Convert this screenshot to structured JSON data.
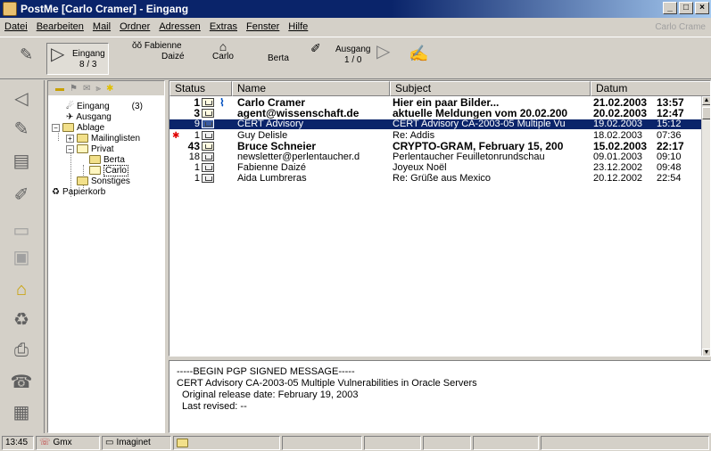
{
  "window": {
    "title": "PostMe [Carlo Cramer] - Eingang",
    "controls": [
      "_",
      "□",
      "×"
    ]
  },
  "menu": {
    "items": [
      "Datei",
      "Bearbeiten",
      "Mail",
      "Ordner",
      "Adressen",
      "Extras",
      "Fenster",
      "Hilfe"
    ],
    "user": "Carlo Crame"
  },
  "toolbar": {
    "inbox_label": "Eingang",
    "inbox_count": "8 / 3",
    "fab_label_1": "Fabienne",
    "fab_label_2": "Daizé",
    "carlo_label": "Carlo",
    "berta_label": "Berta",
    "outbox_label": "Ausgang",
    "outbox_count": "1 / 0"
  },
  "tree": {
    "inbox": "Eingang",
    "inbox_count": "(3)",
    "outbox": "Ausgang",
    "archive": "Ablage",
    "mailing": "Mailinglisten",
    "private": "Privat",
    "berta": "Berta",
    "carlo": "Carlo",
    "misc": "Sonstiges",
    "trash": "Papierkorb"
  },
  "columns": {
    "status": "Status",
    "name": "Name",
    "subject": "Subject",
    "date": "Datum"
  },
  "messages": [
    {
      "count": "1",
      "name": "Carlo Cramer",
      "subject": "Hier ein paar Bilder...",
      "date": "21.02.2003",
      "time": "13:57",
      "bold": true,
      "attachment": true,
      "selected": false,
      "marked": false
    },
    {
      "count": "3",
      "name": "agent@wissenschaft.de",
      "subject": "aktuelle Meldungen vom 20.02.200",
      "date": "20.02.2003",
      "time": "12:47",
      "bold": true,
      "attachment": false,
      "selected": false,
      "marked": false
    },
    {
      "count": "9",
      "name": "CERT Advisory",
      "subject": "CERT Advisory CA-2003-05 Multiple Vu",
      "date": "19.02.2003",
      "time": "15:12",
      "bold": false,
      "attachment": false,
      "selected": true,
      "marked": false
    },
    {
      "count": "1",
      "name": "Guy Delisle",
      "subject": "Re: Addis",
      "date": "18.02.2003",
      "time": "07:36",
      "bold": false,
      "attachment": false,
      "selected": false,
      "marked": true
    },
    {
      "count": "43",
      "name": "Bruce Schneier",
      "subject": "CRYPTO-GRAM, February 15, 200",
      "date": "15.02.2003",
      "time": "22:17",
      "bold": true,
      "attachment": false,
      "selected": false,
      "marked": false
    },
    {
      "count": "18",
      "name": "newsletter@perlentaucher.d",
      "subject": "Perlentaucher Feuilletonrundschau",
      "date": "09.01.2003",
      "time": "09:10",
      "bold": false,
      "attachment": false,
      "selected": false,
      "marked": false
    },
    {
      "count": "1",
      "name": "Fabienne Daizé",
      "subject": "Joyeux Noël",
      "date": "23.12.2002",
      "time": "09:48",
      "bold": false,
      "attachment": false,
      "selected": false,
      "marked": false
    },
    {
      "count": "1",
      "name": "Aida Lumbreras",
      "subject": "Re: Grüße aus Mexico",
      "date": "20.12.2002",
      "time": "22:54",
      "bold": false,
      "attachment": false,
      "selected": false,
      "marked": false
    }
  ],
  "preview": {
    "line1": "-----BEGIN PGP SIGNED MESSAGE-----",
    "line2": "CERT Advisory CA-2003-05 Multiple Vulnerabilities in Oracle Servers",
    "line3": "Original release date: February 19, 2003",
    "line4": "Last revised: --"
  },
  "status": {
    "time": "13:45",
    "account1": "Gmx",
    "account2": "Imaginet"
  },
  "colors": {
    "selection": "#0a246a",
    "title_gradient_end": "#a6caf0",
    "marker": "#e00000"
  }
}
